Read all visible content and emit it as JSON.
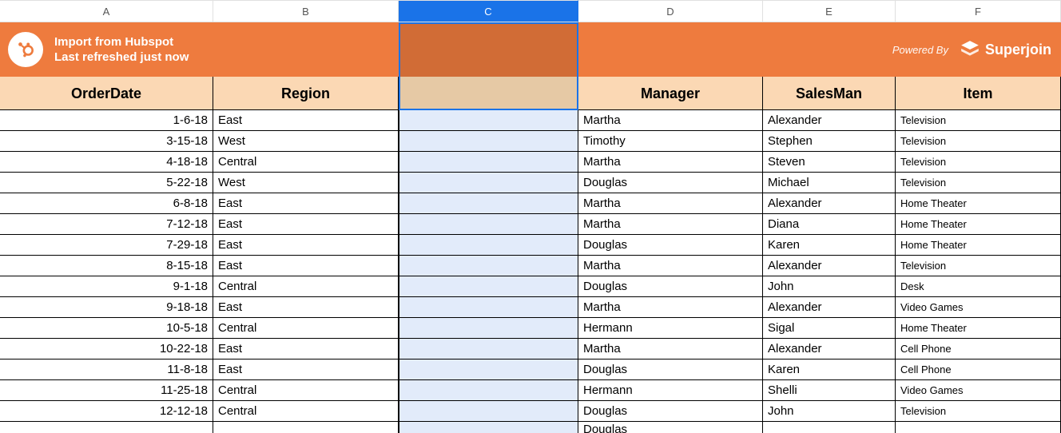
{
  "columns": [
    "A",
    "B",
    "C",
    "D",
    "E",
    "F"
  ],
  "selected_column": "C",
  "banner": {
    "title": "Import from Hubspot",
    "subtitle": "Last refreshed just now",
    "powered_by": "Powered By",
    "brand": "Superjoin"
  },
  "headers": {
    "A": "OrderDate",
    "B": "Region",
    "C": "",
    "D": "Manager",
    "E": "SalesMan",
    "F": "Item"
  },
  "rows": [
    {
      "A": "1-6-18",
      "B": "East",
      "C": "",
      "D": "Martha",
      "E": "Alexander",
      "F": "Television"
    },
    {
      "A": "3-15-18",
      "B": "West",
      "C": "",
      "D": "Timothy",
      "E": "Stephen",
      "F": "Television"
    },
    {
      "A": "4-18-18",
      "B": "Central",
      "C": "",
      "D": "Martha",
      "E": "Steven",
      "F": "Television"
    },
    {
      "A": "5-22-18",
      "B": "West",
      "C": "",
      "D": "Douglas",
      "E": "Michael",
      "F": "Television"
    },
    {
      "A": "6-8-18",
      "B": "East",
      "C": "",
      "D": "Martha",
      "E": "Alexander",
      "F": "Home Theater"
    },
    {
      "A": "7-12-18",
      "B": "East",
      "C": "",
      "D": "Martha",
      "E": "Diana",
      "F": "Home Theater"
    },
    {
      "A": "7-29-18",
      "B": "East",
      "C": "",
      "D": "Douglas",
      "E": "Karen",
      "F": "Home Theater"
    },
    {
      "A": "8-15-18",
      "B": "East",
      "C": "",
      "D": "Martha",
      "E": "Alexander",
      "F": "Television"
    },
    {
      "A": "9-1-18",
      "B": "Central",
      "C": "",
      "D": "Douglas",
      "E": "John",
      "F": "Desk"
    },
    {
      "A": "9-18-18",
      "B": "East",
      "C": "",
      "D": "Martha",
      "E": "Alexander",
      "F": "Video Games"
    },
    {
      "A": "10-5-18",
      "B": "Central",
      "C": "",
      "D": "Hermann",
      "E": "Sigal",
      "F": "Home Theater"
    },
    {
      "A": "10-22-18",
      "B": "East",
      "C": "",
      "D": "Martha",
      "E": "Alexander",
      "F": "Cell Phone"
    },
    {
      "A": "11-8-18",
      "B": "East",
      "C": "",
      "D": "Douglas",
      "E": "Karen",
      "F": "Cell Phone"
    },
    {
      "A": "11-25-18",
      "B": "Central",
      "C": "",
      "D": "Hermann",
      "E": "Shelli",
      "F": "Video Games"
    },
    {
      "A": "12-12-18",
      "B": "Central",
      "C": "",
      "D": "Douglas",
      "E": "John",
      "F": "Television"
    }
  ],
  "partial_row": {
    "A": "",
    "B": "",
    "C": "",
    "D": "Douglas",
    "E": "",
    "F": ""
  }
}
